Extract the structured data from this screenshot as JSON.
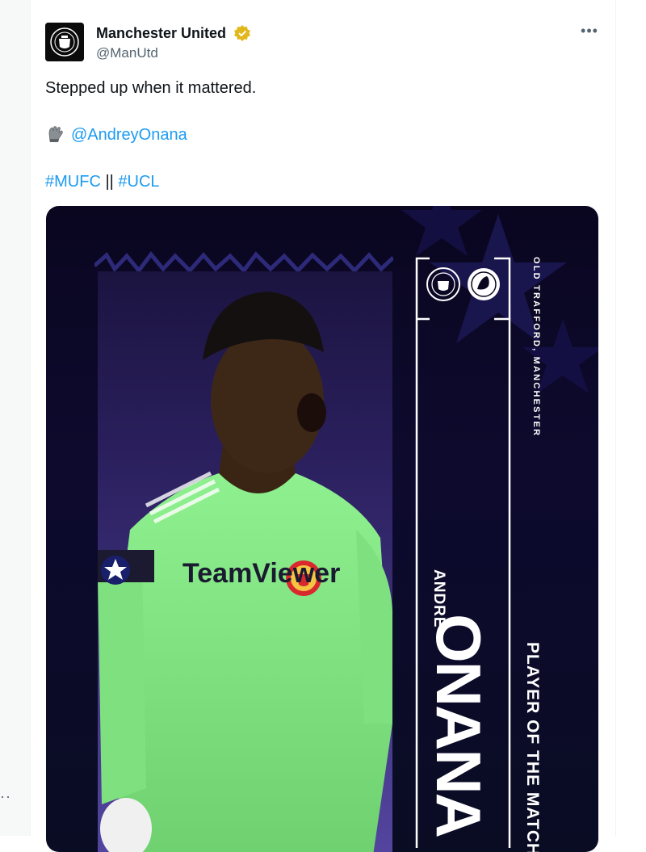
{
  "account": {
    "name": "Manchester United",
    "handle": "@ManUtd",
    "verified": true,
    "badge_color": "#e2b719"
  },
  "tweet": {
    "text": "Stepped up when it mattered.",
    "mention": "@AndreyOnana",
    "hashtag1": "#MUFC",
    "separator": "||",
    "hashtag2": "#UCL"
  },
  "menu": {
    "more_label": "•••"
  },
  "left_gutter": {
    "dots": "··"
  },
  "graphic": {
    "venue": "OLD TRAFFORD, MANCHESTER",
    "first_name": "ANDRE",
    "surname": "ONANA",
    "award": "PLAYER OF THE MATCH",
    "sponsor": "TeamViewer"
  },
  "colors": {
    "link": "#1d9bf0",
    "kit_green": "#7fe07f",
    "background_navy": "#0a0620"
  }
}
